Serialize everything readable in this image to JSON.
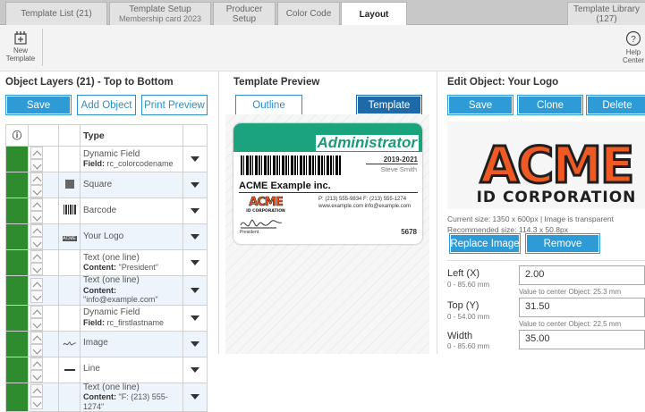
{
  "tabs": [
    {
      "label": "Template List (21)"
    },
    {
      "label": "Template Setup",
      "sub": "Membership card 2023"
    },
    {
      "label": "Producer Setup"
    },
    {
      "label": "Color Code"
    },
    {
      "label": "Layout"
    },
    {
      "label": "Template Library (127)"
    }
  ],
  "toolbar": {
    "new_template": "New Template",
    "help_center": "Help Center",
    "new_label_1": "New",
    "new_label_2": "Template",
    "help_label_1": "Help",
    "help_label_2": "Center"
  },
  "layers": {
    "title": "Object Layers (21) - Top to Bottom",
    "save": "Save",
    "add": "Add Object",
    "print": "Print Preview",
    "type_header": "Type",
    "rows": [
      {
        "type": "Dynamic Field",
        "detail_key": "Field:",
        "detail": "rc_colorcodename",
        "icon": ""
      },
      {
        "type": "Square",
        "detail_key": "",
        "detail": "",
        "icon": "square-icon"
      },
      {
        "type": "Barcode",
        "detail_key": "",
        "detail": "",
        "icon": "barcode-icon"
      },
      {
        "type": "Your Logo",
        "detail_key": "",
        "detail": "",
        "icon": "logo-icon"
      },
      {
        "type": "Text (one line)",
        "detail_key": "Content:",
        "detail": "\"President\"",
        "icon": ""
      },
      {
        "type": "Text (one line)",
        "detail_key": "Content:",
        "detail": "\"info@example.com\"",
        "icon": ""
      },
      {
        "type": "Dynamic Field",
        "detail_key": "Field:",
        "detail": "rc_firstlastname",
        "icon": ""
      },
      {
        "type": "Image",
        "detail_key": "",
        "detail": "",
        "icon": "signature-icon"
      },
      {
        "type": "Line",
        "detail_key": "",
        "detail": "",
        "icon": "line-icon"
      },
      {
        "type": "Text (one line)",
        "detail_key": "Content:",
        "detail": "\"F: (213) 555-1274\"",
        "icon": ""
      }
    ]
  },
  "preview": {
    "title": "Template Preview",
    "outline": "Outline",
    "template": "Template",
    "card": {
      "role": "Administrator",
      "year": "2019-2021",
      "name": "Steve Smith",
      "company": "ACME Example inc.",
      "logo_top": "ACME",
      "logo_bottom": "ID CORPORATION",
      "phone": "P: (213) 555-9834  F: (213) 555-1274",
      "web": "www.example.com  info@example.com",
      "president": "President",
      "number": "5678",
      "accent": "#1ba37e"
    }
  },
  "edit": {
    "title": "Edit Object: Your Logo",
    "save": "Save",
    "clone": "Clone",
    "delete": "Delete",
    "logo_top": "ACME",
    "logo_bottom": "ID CORPORATION",
    "current_size": "Current size: 1350 x 600px | Image is transparent",
    "recommended": "Recommended size: 114.3 x 50.8px",
    "replace": "Replace Image",
    "remove": "Remove",
    "fields": [
      {
        "label": "Left (X)",
        "range": "0 - 85.60 mm",
        "value": "2.00",
        "hint": "Value to center Object: 25.3 mm"
      },
      {
        "label": "Top (Y)",
        "range": "0 - 54.00 mm",
        "value": "31.50",
        "hint": "Value to center Object: 22.5 mm"
      },
      {
        "label": "Width",
        "range": "0 - 85.60 mm",
        "value": "35.00",
        "hint": ""
      }
    ]
  }
}
